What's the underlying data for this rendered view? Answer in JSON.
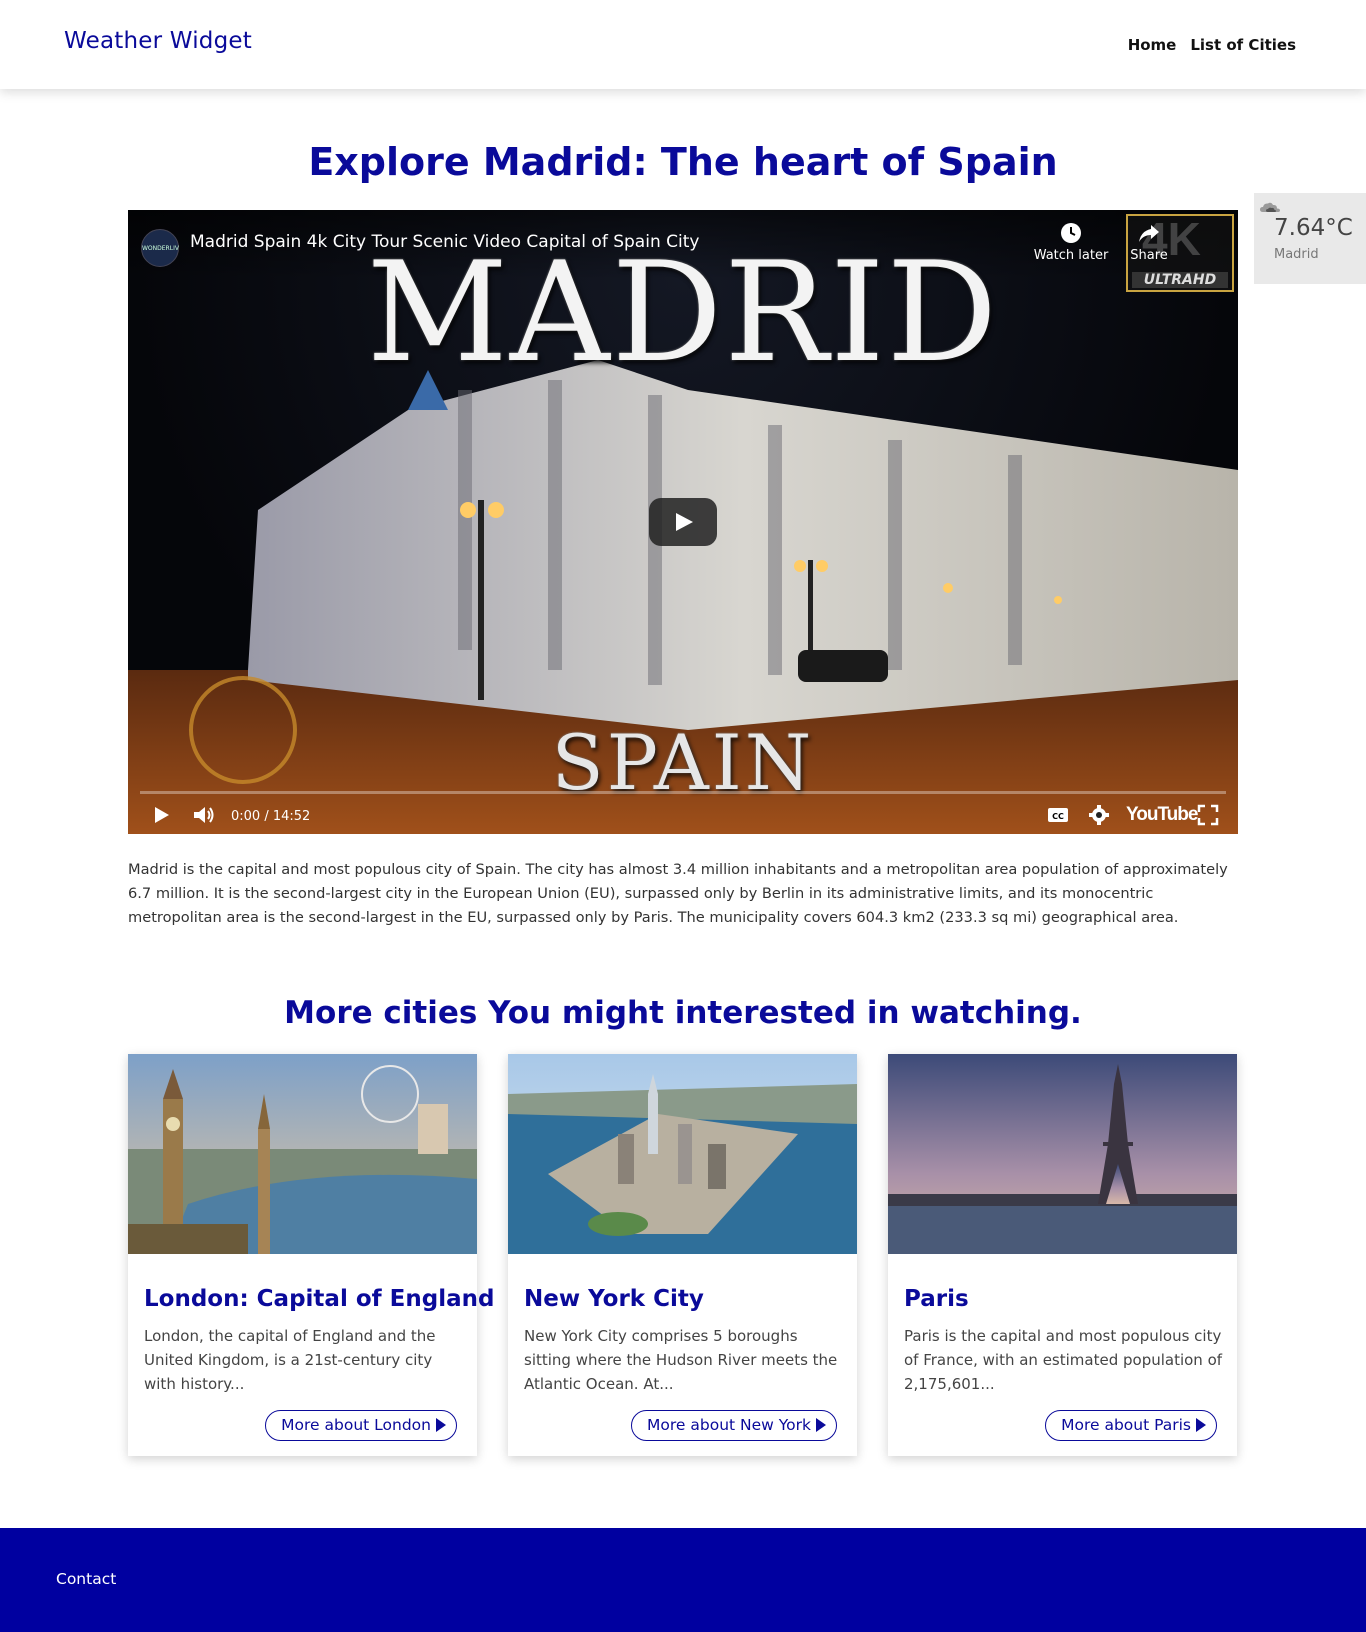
{
  "navbar": {
    "brand": "Weather Widget",
    "links": [
      "Home",
      "List of Cities"
    ]
  },
  "weather": {
    "icon": "cloud-icon",
    "temperature": "7.64°C",
    "city": "Madrid"
  },
  "main": {
    "title": "Explore Madrid: The heart of Spain",
    "video": {
      "title": "Madrid Spain 4k City Tour Scenic Video Capital of Spain City",
      "channel_badge": "WONDERLIV",
      "watch_later": "Watch later",
      "share": "Share",
      "badge_4k": "4K",
      "badge_uhd": "ULTRAHD",
      "overlay_top": "MADRID",
      "overlay_bottom": "SPAIN",
      "time": "0:00 / 14:52",
      "youtube_label": "YouTube"
    },
    "description": "Madrid is the capital and most populous city of Spain. The city has almost 3.4 million inhabitants and a metropolitan area population of approximately 6.7 million. It is the second-largest city in the European Union (EU), surpassed only by Berlin in its administrative limits, and its monocentric metropolitan area is the second-largest in the EU, surpassed only by Paris. The municipality covers 604.3 km2 (233.3 sq mi) geographical area."
  },
  "more": {
    "title": "More cities You might interested in watching.",
    "cards": [
      {
        "title": "London: Capital of England",
        "text": "London, the capital of England and the United Kingdom, is a 21st-century city with history...",
        "button": "More about London"
      },
      {
        "title": "New York City",
        "text": "New York City comprises 5 boroughs sitting where the Hudson River meets the Atlantic Ocean. At...",
        "button": "More about New York"
      },
      {
        "title": "Paris",
        "text": "Paris is the capital and most populous city of France, with an estimated population of 2,175,601...",
        "button": "More about Paris"
      }
    ]
  },
  "footer": {
    "link": "Contact"
  },
  "colors": {
    "accent": "#0a0a9a",
    "footer_bg": "#0000a0",
    "weather_bg": "#e9e9e9"
  }
}
